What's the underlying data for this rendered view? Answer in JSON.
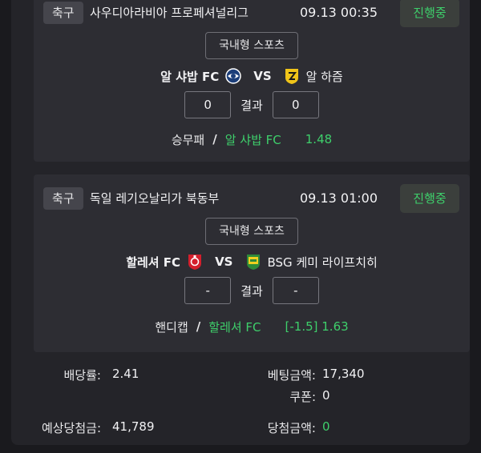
{
  "bets": [
    {
      "sport": "축구",
      "league": "사우디아라비아 프로페셔널리그",
      "datetime": "09.13 00:35",
      "status": "진행중",
      "category": "국내형 스포츠",
      "home_team": "알 샤밥 FC",
      "away_team": "알 하즘",
      "vs": "VS",
      "home_score": "0",
      "away_score": "0",
      "result_label": "결과",
      "bet_type": "승무패",
      "pick": "알 샤밥 FC",
      "odds": "1.48"
    },
    {
      "sport": "축구",
      "league": "독일 레기오날리가 북동부",
      "datetime": "09.13 01:00",
      "status": "진행중",
      "category": "국내형 스포츠",
      "home_team": "할레셔 FC",
      "away_team": "BSG 케미 라이프치히",
      "vs": "VS",
      "home_score": "-",
      "away_score": "-",
      "result_label": "결과",
      "bet_type": "핸디캡",
      "pick": "할레셔 FC",
      "odds": "[-1.5] 1.63"
    }
  ],
  "slash": "/",
  "summary": {
    "odds_label": "배당률:",
    "odds_value": "2.41",
    "bet_amount_label": "베팅금액:",
    "bet_amount_value": "17,340",
    "coupon_label": "쿠폰:",
    "coupon_value": "0",
    "expected_win_label": "예상당첨금:",
    "expected_win_value": "41,789",
    "win_amount_label": "당첨금액:",
    "win_amount_value": "0"
  },
  "colors": {
    "accent_green": "#3ecf6b",
    "background": "#1a1a1e",
    "card": "#2d2d33"
  }
}
